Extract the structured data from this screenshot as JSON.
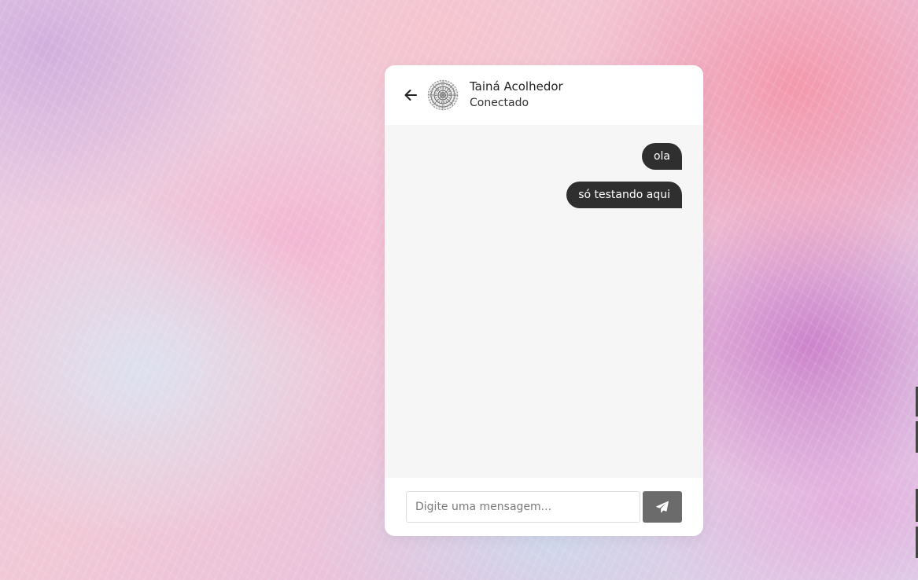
{
  "colors": {
    "bubble": "#2f2f2f",
    "bubble_text": "#ffffff",
    "chat_bg": "#f6f6f6",
    "send_button": "#6b6b6b"
  },
  "header": {
    "back_icon": "arrow-left-icon",
    "avatar_icon": "mandala-avatar",
    "contact_name": "Tainá Acolhedor",
    "status": "Conectado"
  },
  "messages": [
    {
      "text": "ola",
      "direction": "outgoing"
    },
    {
      "text": "só testando aqui",
      "direction": "outgoing"
    }
  ],
  "composer": {
    "value": "",
    "placeholder": "Digite uma mensagem...",
    "send_icon": "paper-plane-icon"
  }
}
